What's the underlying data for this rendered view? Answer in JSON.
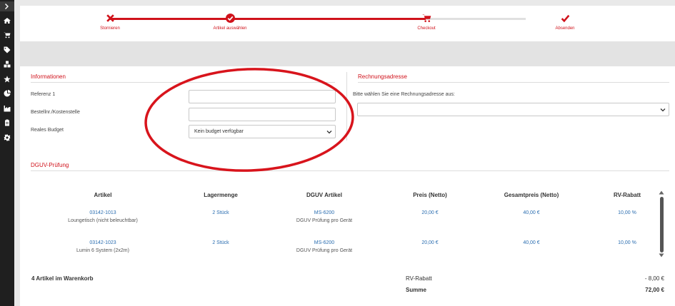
{
  "sidebar": {
    "icons": [
      "chevron-right-icon",
      "home-icon",
      "cart-icon",
      "tag-icon",
      "boxes-icon",
      "star-icon",
      "pie-chart-icon",
      "factory-icon",
      "clipboard-icon",
      "gear-icon"
    ]
  },
  "stepper": {
    "steps": [
      {
        "label": "Stornieren",
        "icon": "x-icon"
      },
      {
        "label": "Artikel auswählen",
        "icon": "check-circle-icon"
      },
      {
        "label": "Checkout",
        "icon": "cart-icon"
      },
      {
        "label": "Absenden",
        "icon": "check-icon"
      }
    ],
    "colors": {
      "active": "#d0121b",
      "inactive": "#e0e0e0"
    }
  },
  "informationen": {
    "title": "Informationen",
    "referenz_label": "Referenz 1",
    "referenz_value": "",
    "bestell_label": "Bestellnr./Kostenstelle",
    "bestell_value": "",
    "budget_label": "Reales Budget",
    "budget_value": "Kein budget verfügbar"
  },
  "rechnungsadresse": {
    "title": "Rechnungsadresse",
    "hint": "Bitte wählen Sie eine Rechnungsadresse aus:",
    "selected": ""
  },
  "dguv": {
    "title": "DGUV-Prüfung",
    "columns": [
      "Artikel",
      "Lagermenge",
      "DGUV Artikel",
      "Preis (Netto)",
      "Gesamtpreis (Netto)",
      "RV-Rabatt"
    ],
    "rows": [
      {
        "artikel_nr": "03142-1013",
        "artikel_name": "Loungetisch (nicht beleuchtbar)",
        "lagermenge": "2 Stück",
        "dguv_nr": "MS-6200",
        "dguv_name": "DGUV Prüfung pro Gerät",
        "preis": "20,00 €",
        "gesamt": "40,00 €",
        "rabatt": "10,00 %"
      },
      {
        "artikel_nr": "03142-1023",
        "artikel_name": "Lumin 6 System (2x2m)",
        "lagermenge": "2 Stück",
        "dguv_nr": "MS-6200",
        "dguv_name": "DGUV Prüfung pro Gerät",
        "preis": "20,00 €",
        "gesamt": "40,00 €",
        "rabatt": "10,00 %"
      }
    ]
  },
  "summary": {
    "items_in_cart": "4 Artikel im Warenkorb",
    "rabatt_label": "RV-Rabatt",
    "rabatt_value": "- 8,00 €",
    "summe_label": "Summe",
    "summe_value": "72,00 €"
  },
  "colors": {
    "accent": "#d0121b",
    "link": "#2a6db0",
    "sidebar": "#1f1f1f"
  }
}
